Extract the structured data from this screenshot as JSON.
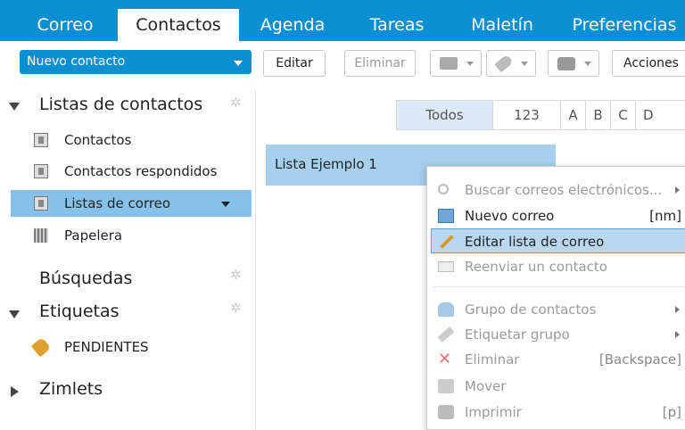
{
  "tabs": [
    "Correo",
    "Contactos",
    "Agenda",
    "Tareas",
    "Maletín",
    "Preferencias"
  ],
  "toolbar": {
    "new_contact": "Nuevo contacto",
    "edit": "Editar",
    "delete": "Eliminar",
    "actions": "Acciones"
  },
  "sidebar": {
    "contact_lists_header": "Listas de contactos",
    "items": [
      "Contactos",
      "Contactos respondidos",
      "Listas de correo",
      "Papelera"
    ],
    "searches_header": "Búsquedas",
    "tags_header": "Etiquetas",
    "tag_item": "PENDIENTES",
    "zimlets_header": "Zimlets"
  },
  "alphabet": [
    "Todos",
    "123",
    "A",
    "B",
    "C",
    "D"
  ],
  "list": {
    "item": "Lista Ejemplo 1"
  },
  "context_menu": {
    "search_emails": "Buscar correos electrónicos...",
    "new_mail": "Nuevo correo",
    "new_mail_shortcut": "[nm]",
    "edit_list": "Editar lista de correo",
    "forward_contact": "Reenviar un contacto",
    "contact_group": "Grupo de contactos",
    "tag_group": "Etiquetar grupo",
    "delete": "Eliminar",
    "delete_shortcut": "[Backspace]",
    "move": "Mover",
    "print": "Imprimir",
    "print_shortcut": "[p]"
  },
  "colors": {
    "accent": "#0a8fd2",
    "selection": "#86c1ea"
  }
}
